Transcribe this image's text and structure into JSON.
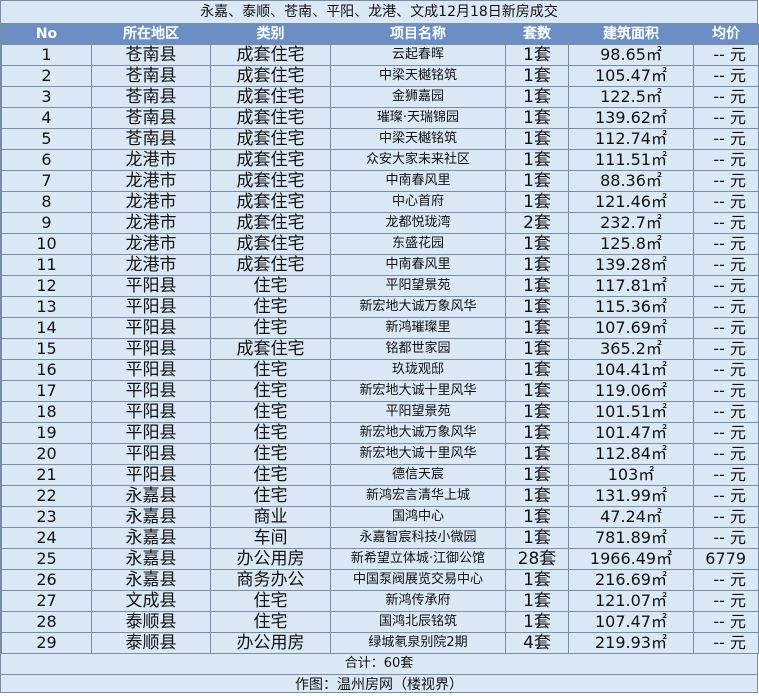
{
  "title": "永嘉、泰顺、苍南、平阳、龙港、文成12月18日新房成交",
  "columns": [
    "No",
    "所在地区",
    "类别",
    "项目名称",
    "套数",
    "建筑面积",
    "均价"
  ],
  "rows": [
    {
      "no": "1",
      "region": "苍南县",
      "type": "成套住宅",
      "project": "云起春晖",
      "units": "1套",
      "area": "98.65㎡",
      "price": "-- 元"
    },
    {
      "no": "2",
      "region": "苍南县",
      "type": "成套住宅",
      "project": "中梁天樾铭筑",
      "units": "1套",
      "area": "105.47㎡",
      "price": "-- 元"
    },
    {
      "no": "3",
      "region": "苍南县",
      "type": "成套住宅",
      "project": "金狮嘉园",
      "units": "1套",
      "area": "122.5㎡",
      "price": "-- 元"
    },
    {
      "no": "4",
      "region": "苍南县",
      "type": "成套住宅",
      "project": "璀璨·天瑞锦园",
      "units": "1套",
      "area": "139.62㎡",
      "price": "-- 元"
    },
    {
      "no": "5",
      "region": "苍南县",
      "type": "成套住宅",
      "project": "中梁天樾铭筑",
      "units": "1套",
      "area": "112.74㎡",
      "price": "-- 元"
    },
    {
      "no": "6",
      "region": "龙港市",
      "type": "成套住宅",
      "project": "众安大家未来社区",
      "units": "1套",
      "area": "111.51㎡",
      "price": "-- 元"
    },
    {
      "no": "7",
      "region": "龙港市",
      "type": "成套住宅",
      "project": "中南春风里",
      "units": "1套",
      "area": "88.36㎡",
      "price": "-- 元"
    },
    {
      "no": "8",
      "region": "龙港市",
      "type": "成套住宅",
      "project": "中心首府",
      "units": "1套",
      "area": "121.46㎡",
      "price": "-- 元"
    },
    {
      "no": "9",
      "region": "龙港市",
      "type": "成套住宅",
      "project": "龙都悦珑湾",
      "units": "2套",
      "area": "232.7㎡",
      "price": "-- 元"
    },
    {
      "no": "10",
      "region": "龙港市",
      "type": "成套住宅",
      "project": "东盛花园",
      "units": "1套",
      "area": "125.8㎡",
      "price": "-- 元"
    },
    {
      "no": "11",
      "region": "龙港市",
      "type": "成套住宅",
      "project": "中南春风里",
      "units": "1套",
      "area": "139.28㎡",
      "price": "-- 元"
    },
    {
      "no": "12",
      "region": "平阳县",
      "type": "住宅",
      "project": "平阳望景苑",
      "units": "1套",
      "area": "117.81㎡",
      "price": "-- 元"
    },
    {
      "no": "13",
      "region": "平阳县",
      "type": "住宅",
      "project": "新宏地大诚万象风华",
      "units": "1套",
      "area": "115.36㎡",
      "price": "-- 元"
    },
    {
      "no": "14",
      "region": "平阳县",
      "type": "住宅",
      "project": "新鸿璀璨里",
      "units": "1套",
      "area": "107.69㎡",
      "price": "-- 元"
    },
    {
      "no": "15",
      "region": "平阳县",
      "type": "成套住宅",
      "project": "铭都世家园",
      "units": "1套",
      "area": "365.2㎡",
      "price": "-- 元"
    },
    {
      "no": "16",
      "region": "平阳县",
      "type": "住宅",
      "project": "玖珑观邸",
      "units": "1套",
      "area": "104.41㎡",
      "price": "-- 元"
    },
    {
      "no": "17",
      "region": "平阳县",
      "type": "住宅",
      "project": "新宏地大诚十里风华",
      "units": "1套",
      "area": "119.06㎡",
      "price": "-- 元"
    },
    {
      "no": "18",
      "region": "平阳县",
      "type": "住宅",
      "project": "平阳望景苑",
      "units": "1套",
      "area": "101.51㎡",
      "price": "-- 元"
    },
    {
      "no": "19",
      "region": "平阳县",
      "type": "住宅",
      "project": "新宏地大诚万象风华",
      "units": "1套",
      "area": "101.47㎡",
      "price": "-- 元"
    },
    {
      "no": "20",
      "region": "平阳县",
      "type": "住宅",
      "project": "新宏地大诚十里风华",
      "units": "1套",
      "area": "112.84㎡",
      "price": "-- 元"
    },
    {
      "no": "21",
      "region": "平阳县",
      "type": "住宅",
      "project": "德信天宸",
      "units": "1套",
      "area": "103㎡",
      "price": "-- 元"
    },
    {
      "no": "22",
      "region": "永嘉县",
      "type": "住宅",
      "project": "新鸿宏言清华上城",
      "units": "1套",
      "area": "131.99㎡",
      "price": "-- 元"
    },
    {
      "no": "23",
      "region": "永嘉县",
      "type": "商业",
      "project": "国鸿中心",
      "units": "1套",
      "area": "47.24㎡",
      "price": "-- 元"
    },
    {
      "no": "24",
      "region": "永嘉县",
      "type": "车间",
      "project": "永嘉智宸科技小微园",
      "units": "1套",
      "area": "781.89㎡",
      "price": "-- 元"
    },
    {
      "no": "25",
      "region": "永嘉县",
      "type": "办公用房",
      "project": "新希望立体城·江御公馆",
      "units": "28套",
      "area": "1966.49㎡",
      "price": "6779"
    },
    {
      "no": "26",
      "region": "永嘉县",
      "type": "商务办公",
      "project": "中国泵阀展览交易中心",
      "units": "1套",
      "area": "216.69㎡",
      "price": "-- 元"
    },
    {
      "no": "27",
      "region": "文成县",
      "type": "住宅",
      "project": "新鸿传承府",
      "units": "1套",
      "area": "121.07㎡",
      "price": "-- 元"
    },
    {
      "no": "28",
      "region": "泰顺县",
      "type": "住宅",
      "project": "国鸿北辰铭筑",
      "units": "1套",
      "area": "107.47㎡",
      "price": "-- 元"
    },
    {
      "no": "29",
      "region": "泰顺县",
      "type": "办公用房",
      "project": "绿城氡泉别院2期",
      "units": "4套",
      "area": "219.93㎡",
      "price": "-- 元"
    }
  ],
  "total": "合计：60套",
  "credit": "作图：温州房网（楼视界）"
}
